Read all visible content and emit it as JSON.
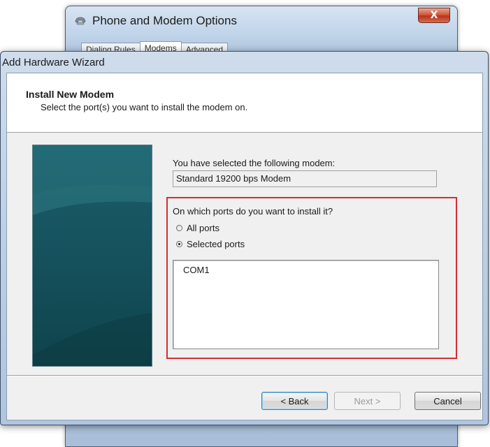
{
  "background_window": {
    "title": "Phone and Modem Options",
    "close_symbol": "X",
    "tabs": [
      "Dialing Rules",
      "Modems",
      "Advanced"
    ],
    "active_tab_index": 1
  },
  "wizard": {
    "title": "Add Hardware Wizard",
    "header": {
      "title": "Install New Modem",
      "subtitle": "Select the port(s) you want to install the modem on."
    },
    "selected_modem_label": "You have selected the following modem:",
    "selected_modem_value": "Standard 19200 bps Modem",
    "ports_question": "On which ports do you want to install it?",
    "port_options": [
      {
        "label": "All ports",
        "selected": false
      },
      {
        "label": "Selected ports",
        "selected": true
      }
    ],
    "port_list": [
      "COM1"
    ],
    "buttons": {
      "back": "< Back",
      "next": "Next >",
      "cancel": "Cancel"
    }
  },
  "colors": {
    "highlight_border": "#d32f34",
    "side_panel": "#16535e",
    "close_button": "#c6452a"
  },
  "icons": {
    "background_window_icon": "phone-modem-icon"
  }
}
